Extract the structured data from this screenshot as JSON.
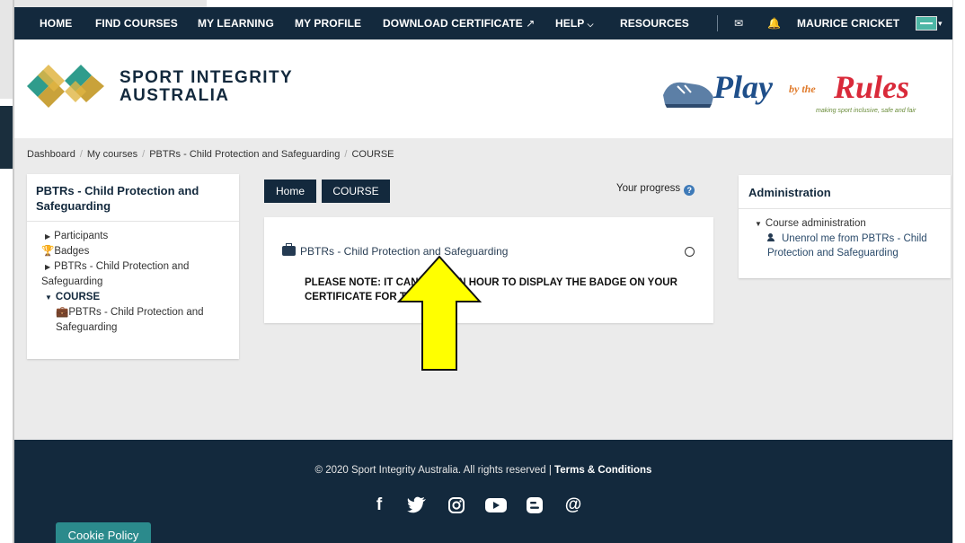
{
  "nav": {
    "home": "HOME",
    "find_courses": "FIND COURSES",
    "my_learning": "MY LEARNING",
    "my_profile": "MY PROFILE",
    "download_certificate": "DOWNLOAD CERTIFICATE",
    "help": "HELP",
    "resources": "RESOURCES",
    "user_name": "MAURICE CRICKET"
  },
  "header": {
    "brand_line1": "SPORT INTEGRITY",
    "brand_line2": "AUSTRALIA",
    "pbtr_play": "Play",
    "pbtr_by": "by the",
    "pbtr_rules": "Rules",
    "pbtr_tagline": "making sport inclusive, safe and fair"
  },
  "breadcrumb": [
    "Dashboard",
    "My courses",
    "PBTRs - Child Protection and Safeguarding",
    "COURSE"
  ],
  "left_block": {
    "title": "PBTRs - Child Protection and Safeguarding",
    "participants": "Participants",
    "badges": "Badges",
    "course_link": "PBTRs - Child Protection and Safeguarding",
    "course_section": "COURSE",
    "activity": "PBTRs - Child Protection and Safeguarding"
  },
  "tabs": [
    "Home",
    "COURSE"
  ],
  "progress_label": "Your progress",
  "main": {
    "activity_name": "PBTRs - Child Protection and Safeguarding",
    "notice": "PLEASE NOTE: IT CAN TAKE AN HOUR TO DISPLAY THE BADGE ON YOUR CERTIFICATE FOR THIS COURSE."
  },
  "admin_block": {
    "title": "Administration",
    "course_admin": "Course administration",
    "unenrol": "Unenrol me from PBTRs - Child Protection and Safeguarding"
  },
  "footer": {
    "copyright": "© 2020 Sport Integrity Australia. All rights reserved |",
    "terms": "Terms & Conditions",
    "social_icons": [
      "facebook-icon",
      "twitter-icon",
      "instagram-icon",
      "youtube-icon",
      "blogger-icon",
      "email-at-icon"
    ],
    "cookie_policy": "Cookie Policy"
  },
  "colors": {
    "navy": "#13293d",
    "teal": "#2b8a8c",
    "arrow_fill": "#ffff00",
    "page_bg": "#ebebeb"
  }
}
